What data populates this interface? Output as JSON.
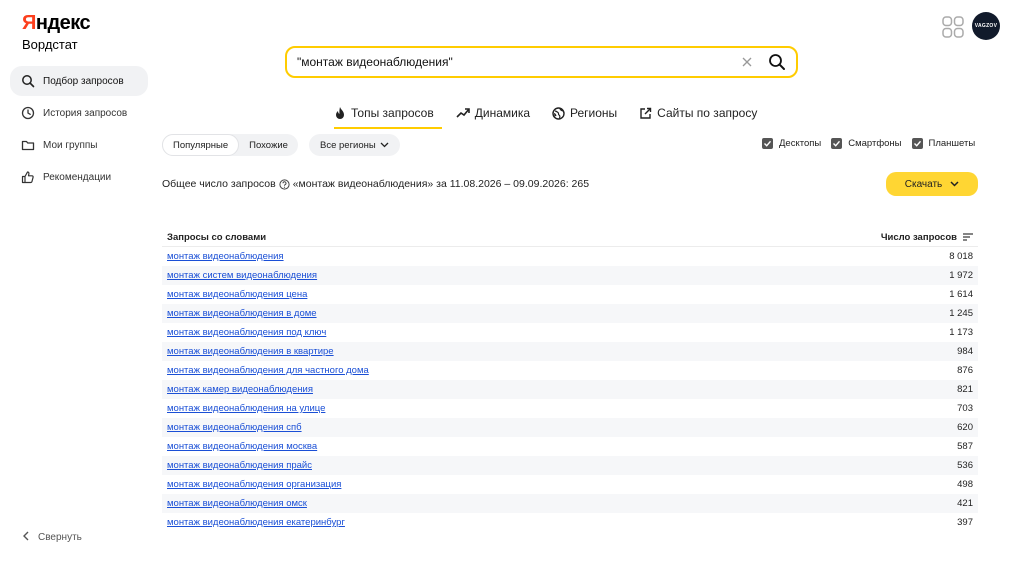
{
  "brand": {
    "logo_first": "Я",
    "logo_rest": "ндекс",
    "product": "Вордстат"
  },
  "sidebar": {
    "items": [
      {
        "label": "Подбор запросов",
        "icon": "search-icon"
      },
      {
        "label": "История запросов",
        "icon": "clock-icon"
      },
      {
        "label": "Мои группы",
        "icon": "folder-icon"
      },
      {
        "label": "Рекомендации",
        "icon": "thumbs-up-icon"
      }
    ],
    "collapse_label": "Свернуть"
  },
  "header": {
    "avatar_text": "VAGZOV"
  },
  "search": {
    "value": "\"монтаж видеонаблюдения\""
  },
  "tabs": [
    {
      "label": "Топы запросов",
      "icon": "fire-icon"
    },
    {
      "label": "Динамика",
      "icon": "trend-icon"
    },
    {
      "label": "Регионы",
      "icon": "globe-icon"
    },
    {
      "label": "Сайты по запросу",
      "icon": "external-link-icon"
    }
  ],
  "filters": {
    "mode_options": [
      "Популярные",
      "Похожие"
    ],
    "regions_label": "Все регионы",
    "devices": [
      "Десктопы",
      "Смартфоны",
      "Планшеты"
    ]
  },
  "summary": {
    "prefix": "Общее число запросов",
    "suffix": "«монтаж видеонаблюдения» за 11.08.2026 – 09.09.2026: 265"
  },
  "download_label": "Скачать",
  "table": {
    "col_query": "Запросы со словами",
    "col_count": "Число запросов",
    "rows": [
      {
        "query": "монтаж видеонаблюдения",
        "count": "8 018"
      },
      {
        "query": "монтаж систем видеонаблюдения",
        "count": "1 972"
      },
      {
        "query": "монтаж видеонаблюдения цена",
        "count": "1 614"
      },
      {
        "query": "монтаж видеонаблюдения в доме",
        "count": "1 245"
      },
      {
        "query": "монтаж видеонаблюдения под ключ",
        "count": "1 173"
      },
      {
        "query": "монтаж видеонаблюдения в квартире",
        "count": "984"
      },
      {
        "query": "монтаж видеонаблюдения для частного дома",
        "count": "876"
      },
      {
        "query": "монтаж камер видеонаблюдения",
        "count": "821"
      },
      {
        "query": "монтаж видеонаблюдения на улице",
        "count": "703"
      },
      {
        "query": "монтаж видеонаблюдения спб",
        "count": "620"
      },
      {
        "query": "монтаж видеонаблюдения москва",
        "count": "587"
      },
      {
        "query": "монтаж видеонаблюдения прайс",
        "count": "536"
      },
      {
        "query": "монтаж видеонаблюдения организация",
        "count": "498"
      },
      {
        "query": "монтаж видеонаблюдения омск",
        "count": "421"
      },
      {
        "query": "монтаж видеонаблюдения екатеринбург",
        "count": "397"
      }
    ]
  },
  "colors": {
    "accent": "#ffcc00",
    "brand_red": "#fc3f1d",
    "link": "#1a4fd6"
  }
}
